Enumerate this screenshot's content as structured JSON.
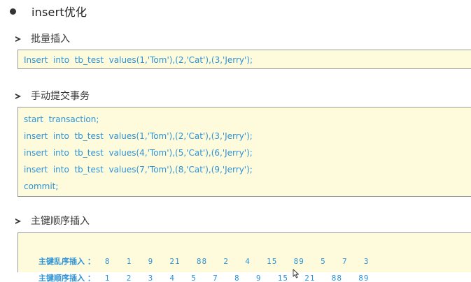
{
  "heading": {
    "title": "insert优化"
  },
  "sections": [
    {
      "title": "批量插入",
      "code": [
        "Insert  into  tb_test  values(1,'Tom'),(2,'Cat'),(3,'Jerry');"
      ]
    },
    {
      "title": "手动提交事务",
      "code": [
        "start  transaction;",
        "insert  into  tb_test  values(1,'Tom'),(2,'Cat'),(3,'Jerry');",
        "insert  into  tb_test  values(4,'Tom'),(5,'Cat'),(6,'Jerry');",
        "insert  into  tb_test  values(7,'Tom'),(8,'Cat'),(9,'Jerry');",
        "commit;"
      ]
    },
    {
      "title": "主键顺序插入",
      "rows": [
        {
          "label": "主键乱序插入 ：",
          "values": "8  1  9  21  88  2  4  15  89  5  7  3"
        },
        {
          "label": "主键顺序插入 ：",
          "values": "1  2  3  4  5  7  8  9  15  21  88  89"
        }
      ]
    }
  ],
  "colors": {
    "code_text": "#2e93d6",
    "code_background": "#fefbdc",
    "border": "#9a9a9a"
  },
  "icons": {
    "bullet": "filled-circle-icon",
    "section_marker": "arrowhead-icon",
    "cursor": "mouse-pointer-icon"
  }
}
